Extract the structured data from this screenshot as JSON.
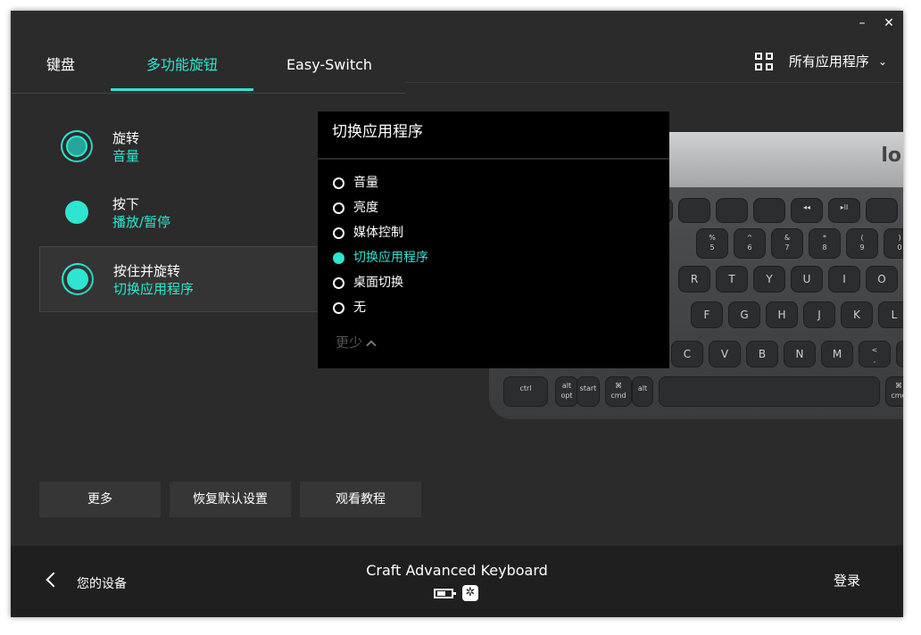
{
  "window": {
    "minimize": "–",
    "close": "✕"
  },
  "tabs": [
    {
      "label": "键盘"
    },
    {
      "label": "多功能旋钮"
    },
    {
      "label": "Easy-Switch"
    }
  ],
  "apps": {
    "label": "所有应用程序"
  },
  "actions": [
    {
      "title": "旋转",
      "value": "音量"
    },
    {
      "title": "按下",
      "value": "播放/暂停"
    },
    {
      "title": "按住并旋转",
      "value": "切换应用程序"
    }
  ],
  "dropdown": {
    "title": "切换应用程序",
    "options": [
      "音量",
      "亮度",
      "媒体控制",
      "切换应用程序",
      "桌面切换",
      "无"
    ],
    "selected_index": 3,
    "less_label": "更少"
  },
  "keyboard": {
    "logo": "lo",
    "fn_row": [
      "",
      "",
      "",
      "",
      "◂◂",
      "▸ll",
      ""
    ],
    "num_row": [
      "%\n5",
      "^\n6",
      "&\n7",
      "*\n8",
      "(\n9",
      ")\n0"
    ],
    "row_q": [
      "R",
      "T",
      "Y",
      "U",
      "I",
      "O"
    ],
    "row_a": [
      "F",
      "G",
      "H",
      "J",
      "K",
      "L"
    ],
    "row_z": [
      "C",
      "V",
      "B",
      "N",
      "M",
      "<\n,",
      ">\n."
    ],
    "row_mod": [
      "ctrl",
      "alt\nopt",
      "start",
      "⌘\ncmd",
      "alt",
      "",
      "⌘\ncmd"
    ]
  },
  "buttons": {
    "more": "更多",
    "reset": "恢复默认设置",
    "tutorial": "观看教程"
  },
  "footer": {
    "back_label": "您的设备",
    "device_name": "Craft Advanced Keyboard",
    "bt_glyph": "✲",
    "login": "登录"
  },
  "colors": {
    "accent": "#2ee5d1",
    "background": "#2b2b2b",
    "footer": "#1f1f1f"
  }
}
